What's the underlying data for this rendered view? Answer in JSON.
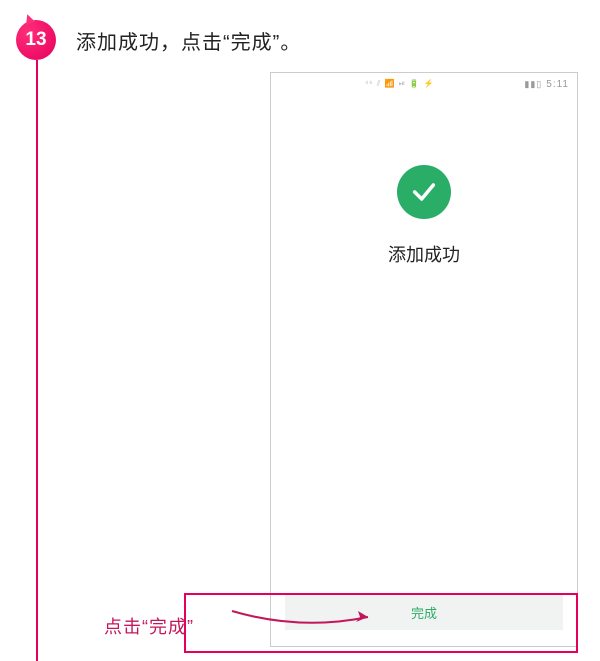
{
  "step": {
    "number": "13",
    "title": "添加成功，点击“完成”。"
  },
  "phone": {
    "status_icons": "⁴⁶ ⫽ 📶 ⏯ 🔋 ⚡",
    "battery": "▮▮▯",
    "time": "5:11",
    "success_message": "添加成功",
    "done_button_label": "完成"
  },
  "callout": {
    "label": "点击“完成”"
  }
}
